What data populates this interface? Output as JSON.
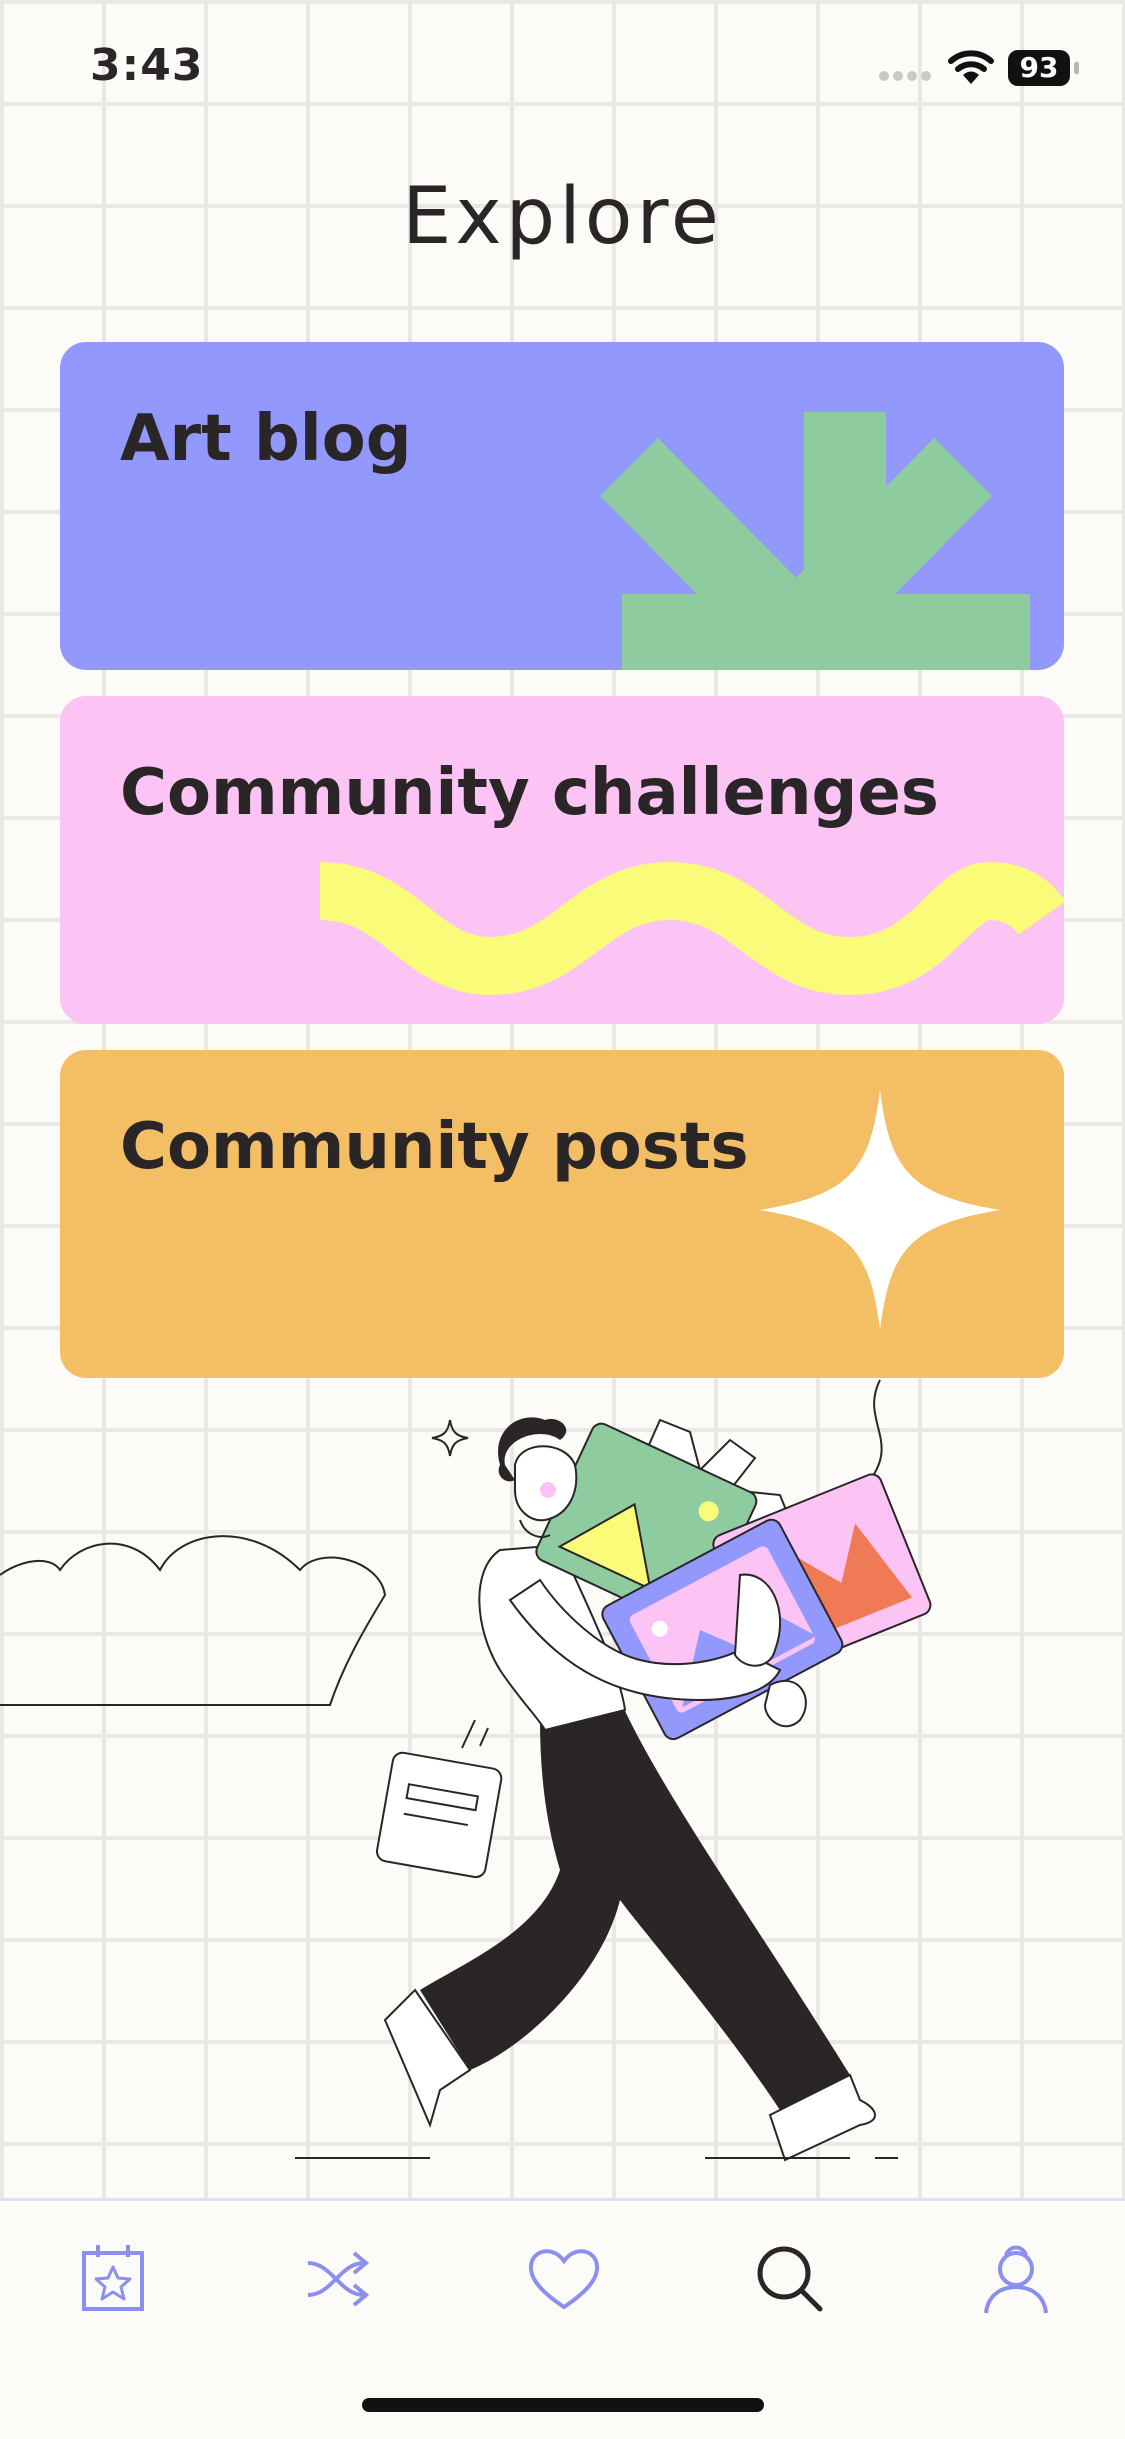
{
  "status_bar": {
    "time": "3:43",
    "battery": "93"
  },
  "header": {
    "title": "Explore"
  },
  "cards": [
    {
      "label": "Art blog",
      "color": "#9399fc",
      "accent": "#8ecb9f"
    },
    {
      "label": "Community challenges",
      "color": "#fcc4f4",
      "accent": "#fbfb7a"
    },
    {
      "label": "Community posts",
      "color": "#f4bf64",
      "accent": "#ffffff"
    }
  ],
  "tab_bar": {
    "tabs": [
      {
        "icon": "calendar-star-icon",
        "active": false
      },
      {
        "icon": "shuffle-icon",
        "active": false
      },
      {
        "icon": "heart-icon",
        "active": false
      },
      {
        "icon": "search-icon",
        "active": true
      },
      {
        "icon": "profile-icon",
        "active": false
      }
    ],
    "accent": "#8b8ff0",
    "active_color": "#2a2628"
  }
}
